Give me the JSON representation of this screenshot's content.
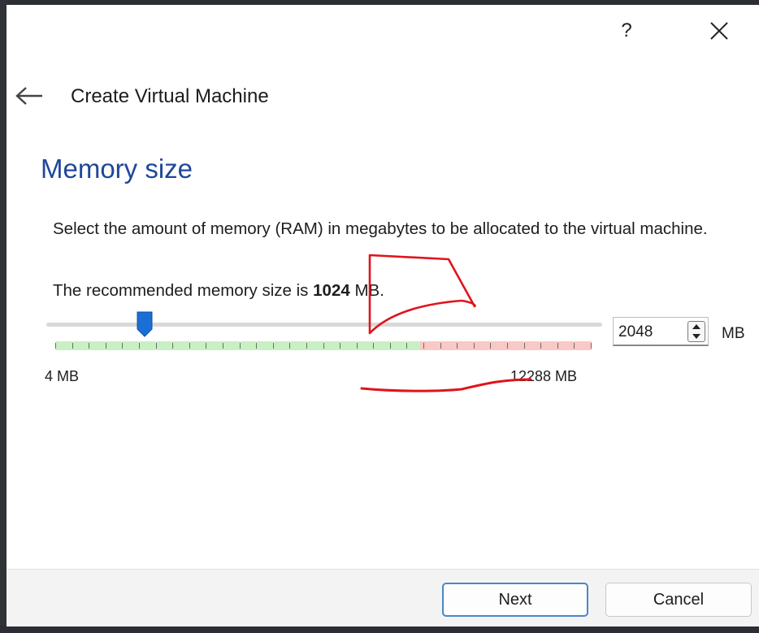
{
  "titlebar": {
    "help_label": "?",
    "close_icon": "close-icon"
  },
  "header": {
    "back_icon": "arrow-left-icon",
    "title": "Create Virtual Machine"
  },
  "page": {
    "heading": "Memory size",
    "description": "Select the amount of memory (RAM) in megabytes to be allocated to the virtual machine.",
    "recommended_prefix": "The recommended memory size is ",
    "recommended_value": "1024",
    "recommended_suffix": " MB."
  },
  "memory": {
    "min": 4,
    "max": 12288,
    "value": 2048,
    "recommended_max_fraction": 0.68,
    "min_label": "4 MB",
    "max_label": "12288 MB",
    "value_text": "2048",
    "unit": "MB",
    "colors": {
      "safe": "#c9f0c4",
      "warning": "#f8c9c6",
      "thumb": "#1a6fd6"
    }
  },
  "footer": {
    "next_label": "Next",
    "cancel_label": "Cancel"
  },
  "annotation_color": "#e0141b"
}
